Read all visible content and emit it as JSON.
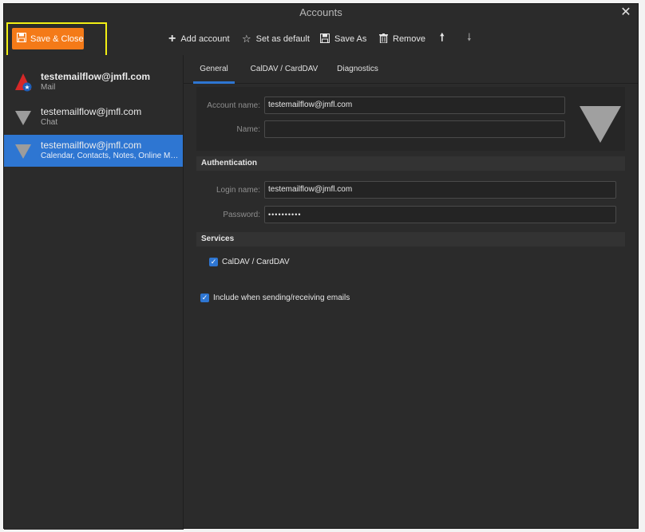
{
  "window": {
    "title": "Accounts",
    "close_glyph": "✕"
  },
  "toolbar": {
    "save_close": "Save & Close",
    "add_account": "Add account",
    "set_default": "Set as default",
    "save_as": "Save As",
    "remove": "Remove"
  },
  "accounts": [
    {
      "email": "testemailflow@jmfl.com",
      "type": "Mail"
    },
    {
      "email": "testemailflow@jmfl.com",
      "type": "Chat"
    },
    {
      "email": "testemailflow@jmfl.com",
      "type": "Calendar, Contacts, Notes, Online Meeti..."
    }
  ],
  "tabs": [
    "General",
    "CalDAV / CardDAV",
    "Diagnostics"
  ],
  "general": {
    "account_name_label": "Account name:",
    "account_name_value": "testemailflow@jmfl.com",
    "name_label": "Name:",
    "name_value": ""
  },
  "authentication": {
    "header": "Authentication",
    "login_label": "Login name:",
    "login_value": "testemailflow@jmfl.com",
    "password_label": "Password:",
    "password_value": "••••••••••"
  },
  "services": {
    "header": "Services",
    "caldav_label": "CalDAV / CardDAV",
    "caldav_checked": true
  },
  "include_sending": {
    "label": "Include when sending/receiving emails",
    "checked": true
  },
  "colors": {
    "accent": "#2e76d2",
    "save_button": "#f47a18",
    "highlight": "#f2ef14"
  }
}
